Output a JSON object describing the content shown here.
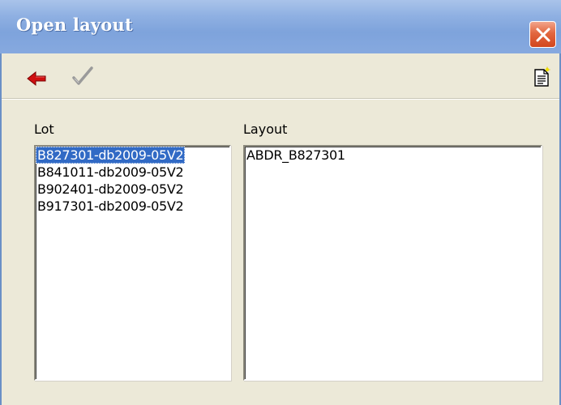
{
  "window": {
    "title": "Open layout",
    "close_icon": "close-icon"
  },
  "toolbar": {
    "back_icon": "red-arrow-left-icon",
    "confirm_icon": "checkmark-icon",
    "document_icon": "document-icon"
  },
  "lot": {
    "label": "Lot",
    "items": [
      "B827301-db2009-05V2",
      "B841011-db2009-05V2",
      "B902401-db2009-05V2",
      "B917301-db2009-05V2"
    ],
    "selected_index": 0
  },
  "layout": {
    "label": "Layout",
    "items": [
      "ABDR_B827301"
    ]
  },
  "colors": {
    "titlebar": "#8fb0e2",
    "dialog_bg": "#ece9d8",
    "selection": "#316ac5",
    "close_button": "#e2673f",
    "arrow": "#d01010"
  }
}
